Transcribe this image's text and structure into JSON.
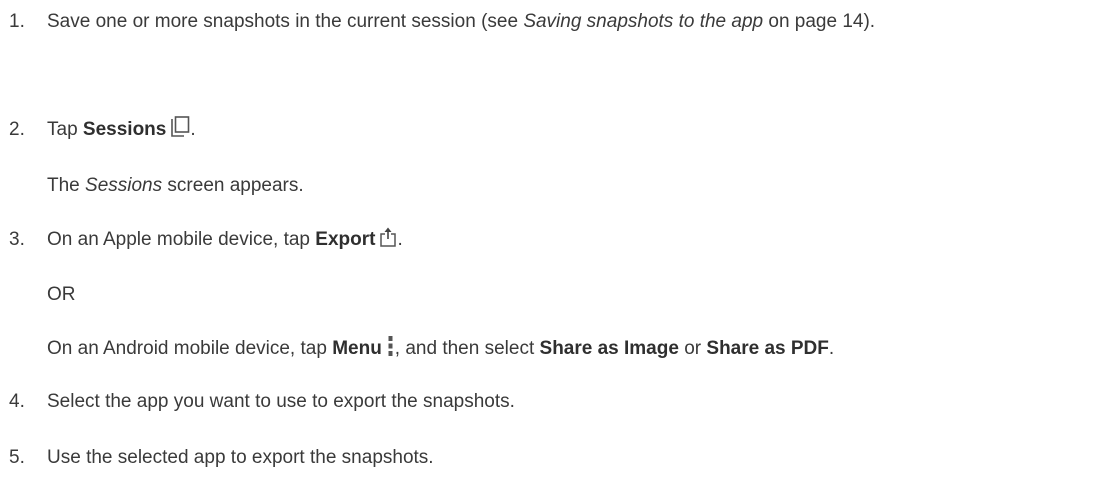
{
  "steps": [
    {
      "number": "1.",
      "text_a": "Save one or more snapshots in the current session (see ",
      "link_text": "Saving snapshots to the app",
      "text_b": " on page 14)."
    },
    {
      "number": "2.",
      "text_a": "Tap ",
      "bold": "Sessions",
      "text_b": ".",
      "icon": "sessions-icon",
      "result_italic": "Sessions",
      "result_rest": " screen appears.",
      "result_prefix": "The "
    },
    {
      "number": "3.",
      "text_a": "On an Apple mobile device, tap ",
      "bold": "Export",
      "text_b": ".",
      "icon": "export-icon",
      "or": "OR",
      "android_a": "On an Android mobile device, tap ",
      "android_bold_menu": "Menu",
      "android_b": ", and then select ",
      "android_bold_image": "Share as Image",
      "android_c": " or ",
      "android_bold_pdf": "Share as PDF",
      "android_d": ".",
      "android_icon": "menu-kebab-icon"
    },
    {
      "number": "4.",
      "text": "Select the app you want to use to export the snapshots."
    },
    {
      "number": "5.",
      "text": "Use the selected app to export the snapshots."
    }
  ]
}
